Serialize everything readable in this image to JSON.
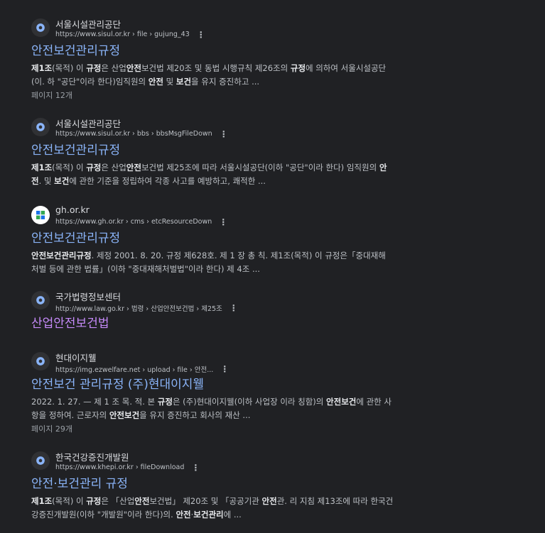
{
  "results": [
    {
      "site_name": "서울시설관리공단",
      "url": "https://www.sisul.or.kr › file › gujung_43",
      "title": "안전보건관리규정",
      "favicon": "globe-icon",
      "snippet_parts": [
        {
          "t": "제1조",
          "b": true
        },
        {
          "t": "(목적) 이 ",
          "b": false
        },
        {
          "t": "규정",
          "b": true
        },
        {
          "t": "은 산업",
          "b": false
        },
        {
          "t": "안전",
          "b": true
        },
        {
          "t": "보건법 제20조 및 동법 시행규칙 제26조의 ",
          "b": false
        },
        {
          "t": "규정",
          "b": true
        },
        {
          "t": "에 의하여 서울시설공단(이. 하 \"공단\"이라 한다)임직원의 ",
          "b": false
        },
        {
          "t": "안전",
          "b": true
        },
        {
          "t": " 및 ",
          "b": false
        },
        {
          "t": "보건",
          "b": true
        },
        {
          "t": "을 유지 증진하고 ...",
          "b": false
        }
      ],
      "pages": "페이지 12개"
    },
    {
      "site_name": "서울시설관리공단",
      "url": "https://www.sisul.or.kr › bbs › bbsMsgFileDown",
      "title": "안전보건관리규정",
      "favicon": "globe-icon",
      "snippet_parts": [
        {
          "t": "제1조",
          "b": true
        },
        {
          "t": "(목적) 이 ",
          "b": false
        },
        {
          "t": "규정",
          "b": true
        },
        {
          "t": "은 산업",
          "b": false
        },
        {
          "t": "안전",
          "b": true
        },
        {
          "t": "보건법 제25조에 따라 서울시설공단(이하 \"공단\"이라 한다) 임직원의 ",
          "b": false
        },
        {
          "t": "안전",
          "b": true
        },
        {
          "t": ". 및 ",
          "b": false
        },
        {
          "t": "보건",
          "b": true
        },
        {
          "t": "에 관한 기준을 정립하여 각종 사고를 예방하고, 쾌적한 ...",
          "b": false
        }
      ],
      "pages": ""
    },
    {
      "site_name": "gh.or.kr",
      "url": "https://www.gh.or.kr › cms › etcResourceDown",
      "title": "안전보건관리규정",
      "favicon": "gh-logo-icon",
      "snippet_parts": [
        {
          "t": "안전보건관리규정",
          "b": true
        },
        {
          "t": ". 제정 2001. 8. 20. 규정 제628호. 제 1 장 총 칙. 제1조(목적) 이 규정은「중대재해 처벌 등에 관한 법률」(이하 \"중대재해처벌법\"이라 한다) 제 4조 ...",
          "b": false
        }
      ],
      "pages": ""
    },
    {
      "site_name": "국가법령정보센터",
      "url": "http://www.law.go.kr › 법령 › 산업안전보건법 › 제25조",
      "title": "산업안전보건법",
      "favicon": "globe-icon",
      "snippet_parts": [],
      "pages": ""
    },
    {
      "site_name": "현대이지웰",
      "url": "https://img.ezwelfare.net › upload › file › 안전...",
      "title": "안전보건 관리규정 (주)현대이지웰",
      "favicon": "globe-icon",
      "snippet_parts": [
        {
          "t": "2022. 1. 27. — 제 1 조 목. 적. 본 ",
          "b": false
        },
        {
          "t": "규정",
          "b": true
        },
        {
          "t": "은 (주)현대이지웰(이하 사업장 이라 칭함)의 ",
          "b": false
        },
        {
          "t": "안전보건",
          "b": true
        },
        {
          "t": "에 관한 사항을 정하여. 근로자의 ",
          "b": false
        },
        {
          "t": "안전보건",
          "b": true
        },
        {
          "t": "을 유지 증진하고 회사의 재산 ...",
          "b": false
        }
      ],
      "pages": "페이지 29개"
    },
    {
      "site_name": "한국건강증진개발원",
      "url": "https://www.khepi.or.kr › fileDownload",
      "title": "안전·보건관리 규정",
      "favicon": "globe-icon",
      "snippet_parts": [
        {
          "t": "제1조",
          "b": true
        },
        {
          "t": "(목적) 이 ",
          "b": false
        },
        {
          "t": "규정",
          "b": true
        },
        {
          "t": "은 「산업",
          "b": false
        },
        {
          "t": "안전",
          "b": true
        },
        {
          "t": "보건법」 제20조 및 「공공기관 ",
          "b": false
        },
        {
          "t": "안전",
          "b": true
        },
        {
          "t": "관. 리 지침 제13조에 따라 한국건강증진개발원(이하 \"개발원\"이라 한다)의. ",
          "b": false
        },
        {
          "t": "안전",
          "b": true
        },
        {
          "t": "·",
          "b": false
        },
        {
          "t": "보건관리",
          "b": true
        },
        {
          "t": "에 ...",
          "b": false
        }
      ],
      "pages": ""
    }
  ],
  "more_options_glyph": "⋮"
}
